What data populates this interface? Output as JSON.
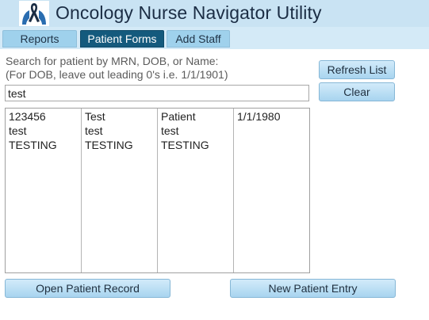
{
  "app": {
    "title": "Oncology Nurse Navigator Utility",
    "colors": {
      "header_bg": "#c9e3f3",
      "active_tab": "#145a7d",
      "button": "#a8d4ef"
    }
  },
  "tabs": [
    {
      "label": "Reports",
      "active": false
    },
    {
      "label": "Patient Forms",
      "active": true
    },
    {
      "label": "Add Staff",
      "active": false
    }
  ],
  "search": {
    "help_line1": "Search for patient by MRN, DOB, or Name:",
    "help_line2": "(For DOB, leave out leading 0's i.e. 1/1/1901)",
    "value": "test"
  },
  "buttons": {
    "refresh": "Refresh List",
    "clear": "Clear",
    "open_record": "Open Patient Record",
    "new_entry": "New Patient Entry"
  },
  "results": {
    "columns": [
      [
        "123456",
        "test",
        "TESTING"
      ],
      [
        "Test",
        "test",
        "TESTING"
      ],
      [
        "Patient",
        "test",
        "TESTING"
      ],
      [
        "1/1/1980"
      ]
    ]
  }
}
